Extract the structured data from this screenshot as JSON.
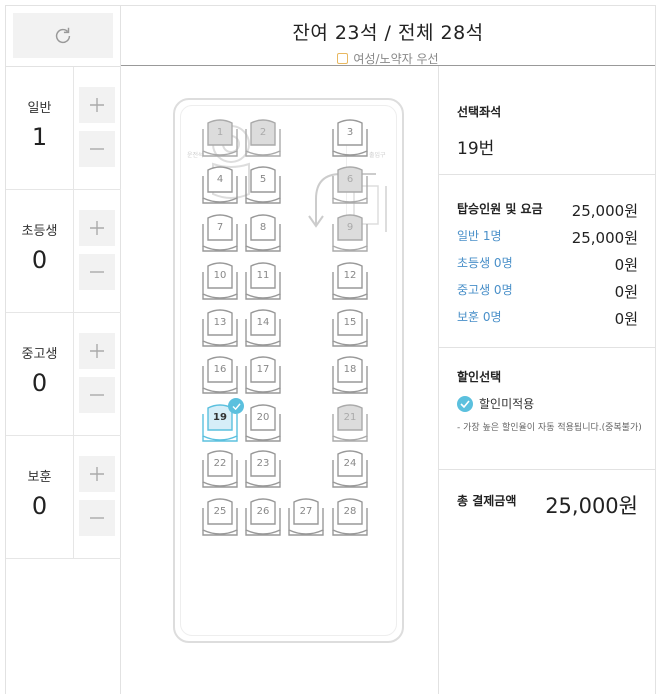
{
  "header": {
    "title": "잔여 23석 / 전체 28석",
    "preference_label": "여성/노약자 우선"
  },
  "counters": [
    {
      "label": "일반",
      "value": "1"
    },
    {
      "label": "초등생",
      "value": "0"
    },
    {
      "label": "중고생",
      "value": "0"
    },
    {
      "label": "보훈",
      "value": "0"
    }
  ],
  "bus": {
    "driver_label": "운전석",
    "door_label": "출입구",
    "seats": [
      {
        "n": "1",
        "status": "taken"
      },
      {
        "n": "2",
        "status": "taken"
      },
      {
        "n": "3",
        "status": "available"
      },
      {
        "n": "4",
        "status": "available"
      },
      {
        "n": "5",
        "status": "available"
      },
      {
        "n": "6",
        "status": "taken"
      },
      {
        "n": "7",
        "status": "available"
      },
      {
        "n": "8",
        "status": "available"
      },
      {
        "n": "9",
        "status": "taken"
      },
      {
        "n": "10",
        "status": "available"
      },
      {
        "n": "11",
        "status": "available"
      },
      {
        "n": "12",
        "status": "available"
      },
      {
        "n": "13",
        "status": "available"
      },
      {
        "n": "14",
        "status": "available"
      },
      {
        "n": "15",
        "status": "available"
      },
      {
        "n": "16",
        "status": "available"
      },
      {
        "n": "17",
        "status": "available"
      },
      {
        "n": "18",
        "status": "available"
      },
      {
        "n": "19",
        "status": "selected"
      },
      {
        "n": "20",
        "status": "available"
      },
      {
        "n": "21",
        "status": "taken"
      },
      {
        "n": "22",
        "status": "available"
      },
      {
        "n": "23",
        "status": "available"
      },
      {
        "n": "24",
        "status": "available"
      },
      {
        "n": "25",
        "status": "available"
      },
      {
        "n": "26",
        "status": "available"
      },
      {
        "n": "27",
        "status": "available"
      },
      {
        "n": "28",
        "status": "available"
      }
    ]
  },
  "summary": {
    "selected_title": "선택좌석",
    "selected_value": "19번",
    "fare_title": "탑승인원 및 요금",
    "fare_total": "25,000원",
    "fares": [
      {
        "label": "일반 1명",
        "value": "25,000원"
      },
      {
        "label": "초등생 0명",
        "value": "0원"
      },
      {
        "label": "중고생 0명",
        "value": "0원"
      },
      {
        "label": "보훈 0명",
        "value": "0원"
      }
    ],
    "discount_title": "할인선택",
    "discount_option": "할인미적용",
    "discount_note": "- 가장 높은 할인율이 자동 적용됩니다.(중복불가)",
    "total_title": "총 결제금액",
    "total_value": "25,000원"
  },
  "colors": {
    "accent": "#5bc0de",
    "link": "#4a90c9",
    "seat_taken": "#dcdcdc",
    "seat_selected": "#d6eef8"
  }
}
